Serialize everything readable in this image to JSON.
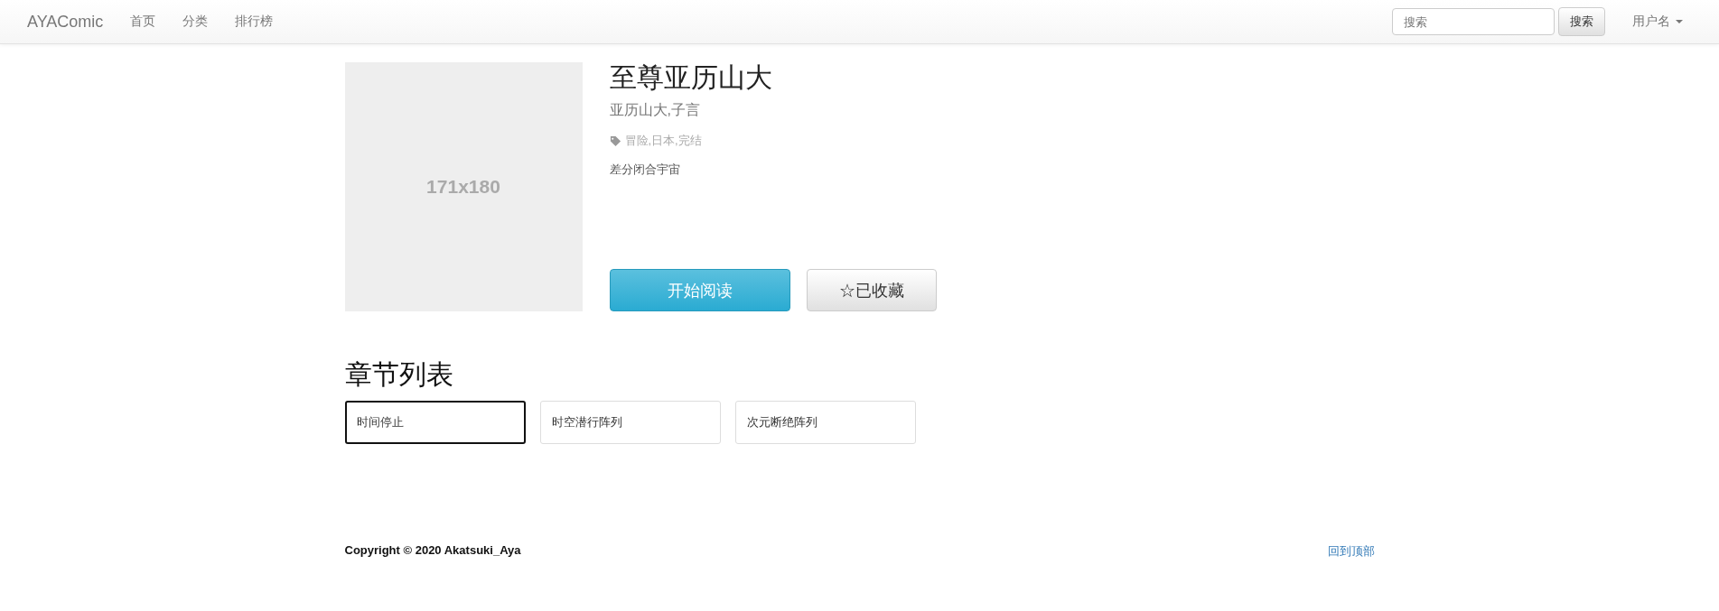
{
  "navbar": {
    "brand": "AYAComic",
    "links": [
      {
        "label": "首页"
      },
      {
        "label": "分类"
      },
      {
        "label": "排行榜"
      }
    ],
    "search": {
      "placeholder": "搜索",
      "button": "搜索"
    },
    "user": "用户名"
  },
  "comic": {
    "cover": "171x180",
    "title": "至尊亚历山大",
    "authors": "亚历山大,子言",
    "tags": "冒险,日本,完结",
    "description": "差分闭合宇宙",
    "read_button": "开始阅读",
    "favorite_button": "☆已收藏"
  },
  "chapters": {
    "heading": "章节列表",
    "items": [
      {
        "title": "时间停止",
        "selected": true
      },
      {
        "title": "时空潜行阵列",
        "selected": false
      },
      {
        "title": "次元断绝阵列",
        "selected": false
      }
    ]
  },
  "footer": {
    "copyright": "Copyright © 2020 Akatsuki_Aya",
    "back_to_top": "回到顶部"
  }
}
